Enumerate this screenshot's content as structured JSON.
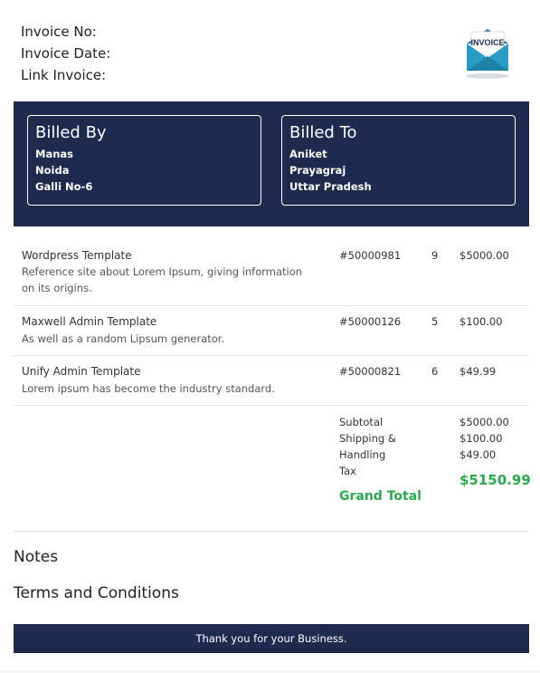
{
  "header": {
    "invoice_no_label": "Invoice No:",
    "invoice_date_label": "Invoice Date:",
    "link_invoice_label": "Link Invoice:",
    "logo_text": "INVOICE"
  },
  "billed_by": {
    "title": "Billed By",
    "name": "Manas",
    "city": "Noida",
    "address": "Galli No-6"
  },
  "billed_to": {
    "title": "Billed To",
    "name": "Aniket",
    "city": "Prayagraj",
    "state": "Uttar Pradesh"
  },
  "items": [
    {
      "name": "Wordpress Template",
      "description": "Reference site about Lorem Ipsum, giving information on its origins.",
      "id": "#50000981",
      "qty": "9",
      "price": "$5000.00"
    },
    {
      "name": "Maxwell Admin Template",
      "description": "As well as a random Lipsum generator.",
      "id": "#50000126",
      "qty": "5",
      "price": "$100.00"
    },
    {
      "name": "Unify Admin Template",
      "description": "Lorem ipsum has become the industry standard.",
      "id": "#50000821",
      "qty": "6",
      "price": "$49.99"
    }
  ],
  "totals": {
    "subtotal_label": "Subtotal",
    "shipping_label": "Shipping & Handling",
    "tax_label": "Tax",
    "subtotal_value": "$5000.00",
    "shipping_value": "$100.00",
    "tax_value": "$49.00",
    "grand_total_label": "Grand Total",
    "grand_total_value": "$5150.99"
  },
  "sections": {
    "notes": "Notes",
    "terms": "Terms and Conditions"
  },
  "footer": {
    "message": "Thank you for your Business."
  },
  "colors": {
    "navy": "#1e2b4f",
    "green": "#2ea84f"
  }
}
